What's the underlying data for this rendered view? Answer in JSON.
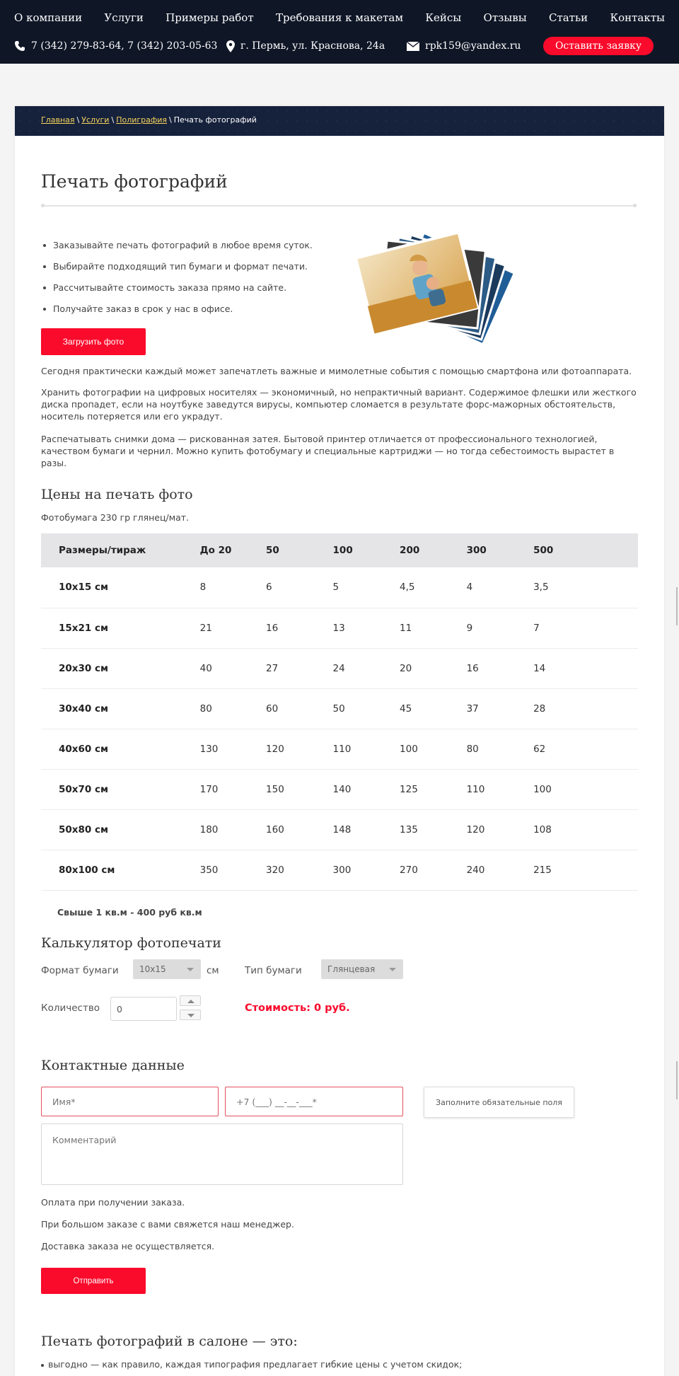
{
  "header": {
    "nav": [
      "О компании",
      "Услуги",
      "Примеры работ",
      "Требования к макетам",
      "Кейсы",
      "Отзывы",
      "Статьи",
      "Контакты"
    ],
    "phones": "7 (342) 279-83-64, 7 (342) 203-05-63",
    "address": "г. Пермь, ул. Краснова, 24а",
    "email": "rpk159@yandex.ru",
    "request_button": "Оставить заявку"
  },
  "breadcrumb": {
    "items": [
      "Главная",
      "Услуги",
      "Полиграфия"
    ],
    "current": "Печать фотографий"
  },
  "page": {
    "title": "Печать фотографий",
    "bullets": [
      "Заказывайте печать фотографий в любое время суток.",
      "Выбирайте подходящий тип бумаги и формат печати.",
      "Рассчитывайте стоимость заказа прямо на сайте.",
      "Получайте заказ в срок у нас в офисе."
    ],
    "upload_button": "Загрузить фото",
    "paragraphs": [
      "Сегодня практически каждый может запечатлеть важные и мимолетные события с помощью смартфона или фотоаппарата.",
      "Хранить фотографии на цифровых носителях — экономичный, но непрактичный вариант. Содержимое флешки или жесткого диска пропадет, если на ноутбуке заведутся вирусы, компьютер сломается в результате форс-мажорных обстоятельств, носитель потеряется или его украдут.",
      "Распечатывать снимки дома — рискованная затея. Бытовой принтер отличается от профессионального технологией, качеством бумаги и чернил. Можно купить фотобумагу и специальные картриджи — но тогда себестоимость вырастет в разы."
    ]
  },
  "prices": {
    "title": "Цены на печать фото",
    "paper_note": "Фотобумага 230 гр глянец/мат.",
    "headers": [
      "Размеры/тираж",
      "До 20",
      "50",
      "100",
      "200",
      "300",
      "500"
    ],
    "rows": [
      [
        "10x15 см",
        "8",
        "6",
        "5",
        "4,5",
        "4",
        "3,5"
      ],
      [
        "15x21 см",
        "21",
        "16",
        "13",
        "11",
        "9",
        "7"
      ],
      [
        "20x30 см",
        "40",
        "27",
        "24",
        "20",
        "16",
        "14"
      ],
      [
        "30x40 см",
        "80",
        "60",
        "50",
        "45",
        "37",
        "28"
      ],
      [
        "40x60 см",
        "130",
        "120",
        "110",
        "100",
        "80",
        "62"
      ],
      [
        "50x70 см",
        "170",
        "150",
        "140",
        "125",
        "110",
        "100"
      ],
      [
        "50x80 см",
        "180",
        "160",
        "148",
        "135",
        "120",
        "108"
      ],
      [
        "80x100 см",
        "350",
        "320",
        "300",
        "270",
        "240",
        "215"
      ]
    ],
    "above_note": "Свыше 1 кв.м - 400 руб кв.м"
  },
  "calculator": {
    "title": "Калькулятор фотопечати",
    "format_label": "Формат бумаги",
    "format_value": "10x15",
    "unit": "см",
    "paper_label": "Тип бумаги",
    "paper_value": "Глянцевая",
    "qty_label": "Количество",
    "qty_value": "0",
    "cost": "Стоимость: 0 руб."
  },
  "contact_form": {
    "title": "Контактные данные",
    "name_placeholder": "Имя*",
    "phone_placeholder": "+7 (___) __-__-___*",
    "required_note": "Заполните обязательные поля",
    "comment_placeholder": "Комментарий",
    "info": [
      "Оплата при получении заказа.",
      "При большом заказе с вами свяжется наш менеджер.",
      "Доставка заказа не осуществляется."
    ],
    "submit": "Отправить"
  },
  "salon": {
    "title": "Печать фотографий в салоне — это:",
    "items": [
      "выгодно — как правило, каждая типография предлагает гибкие цены с учетом скидок;"
    ]
  },
  "colors": {
    "header_bg": "#0f1626",
    "accent": "#fa0a2b",
    "breadcrumb_link": "#f6d25c"
  }
}
